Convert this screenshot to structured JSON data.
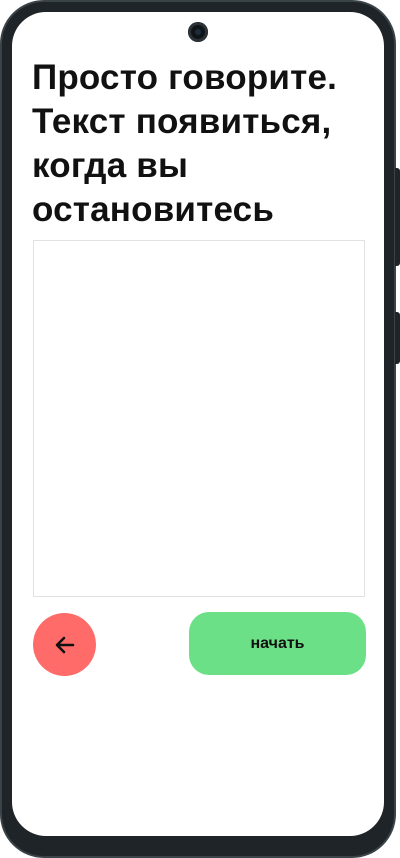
{
  "screen": {
    "title": "Просто говорите. Текст появиться, когда вы остановитесь",
    "transcript_text": ""
  },
  "actions": {
    "back_icon": "arrow-left-icon",
    "start_label": "начать"
  },
  "colors": {
    "back_button": "#ff6b69",
    "start_button": "#6ce086",
    "frame": "#1e2428"
  }
}
